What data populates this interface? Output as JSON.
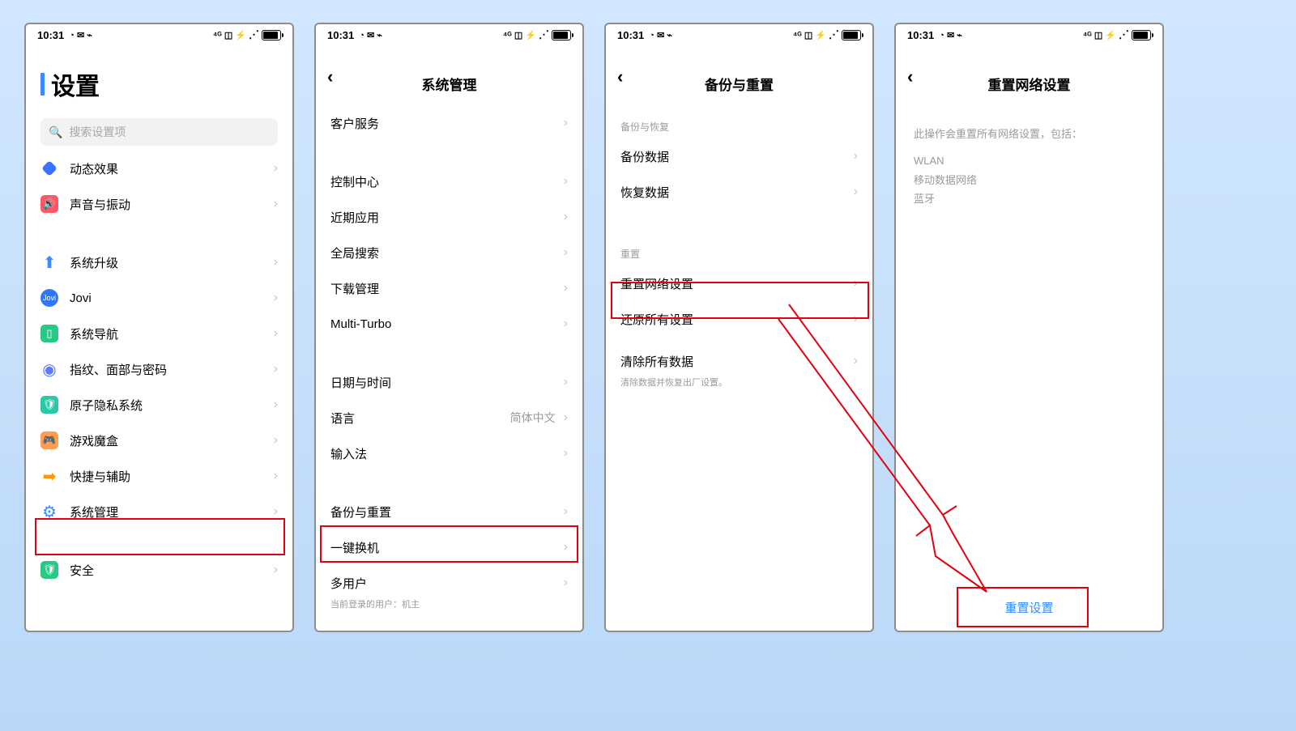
{
  "status": {
    "time": "10:31",
    "icons_left": "◔ ✉ ⌁",
    "icons_right": "⁴ᴳ ◫ ⚡"
  },
  "screen1": {
    "title": "设置",
    "search_placeholder": "搜索设置项",
    "items": [
      {
        "label": "动态效果"
      },
      {
        "label": "声音与振动"
      }
    ],
    "group2": [
      {
        "label": "系统升级"
      },
      {
        "label": "Jovi"
      },
      {
        "label": "系统导航"
      },
      {
        "label": "指纹、面部与密码"
      },
      {
        "label": "原子隐私系统"
      },
      {
        "label": "游戏魔盒"
      },
      {
        "label": "快捷与辅助"
      },
      {
        "label": "系统管理"
      }
    ],
    "group3": [
      {
        "label": "安全"
      }
    ]
  },
  "screen2": {
    "title": "系统管理",
    "g1": [
      {
        "label": "客户服务"
      }
    ],
    "g2": [
      {
        "label": "控制中心"
      },
      {
        "label": "近期应用"
      },
      {
        "label": "全局搜索"
      },
      {
        "label": "下载管理"
      },
      {
        "label": "Multi-Turbo"
      }
    ],
    "g3": [
      {
        "label": "日期与时间"
      },
      {
        "label": "语言",
        "value": "简体中文"
      },
      {
        "label": "输入法"
      }
    ],
    "g4": [
      {
        "label": "备份与重置"
      },
      {
        "label": "一键换机"
      },
      {
        "label": "多用户",
        "sub": "当前登录的用户：机主"
      }
    ]
  },
  "screen3": {
    "title": "备份与重置",
    "sect1": "备份与恢复",
    "g1": [
      {
        "label": "备份数据"
      },
      {
        "label": "恢复数据"
      }
    ],
    "sect2": "重置",
    "g2": [
      {
        "label": "重置网络设置"
      },
      {
        "label": "还原所有设置"
      },
      {
        "label": "清除所有数据",
        "sub": "清除数据并恢复出厂设置。"
      }
    ]
  },
  "screen4": {
    "title": "重置网络设置",
    "desc": "此操作会重置所有网络设置，包括：",
    "items": [
      "WLAN",
      "移动数据网络",
      "蓝牙"
    ],
    "button": "重置设置"
  }
}
